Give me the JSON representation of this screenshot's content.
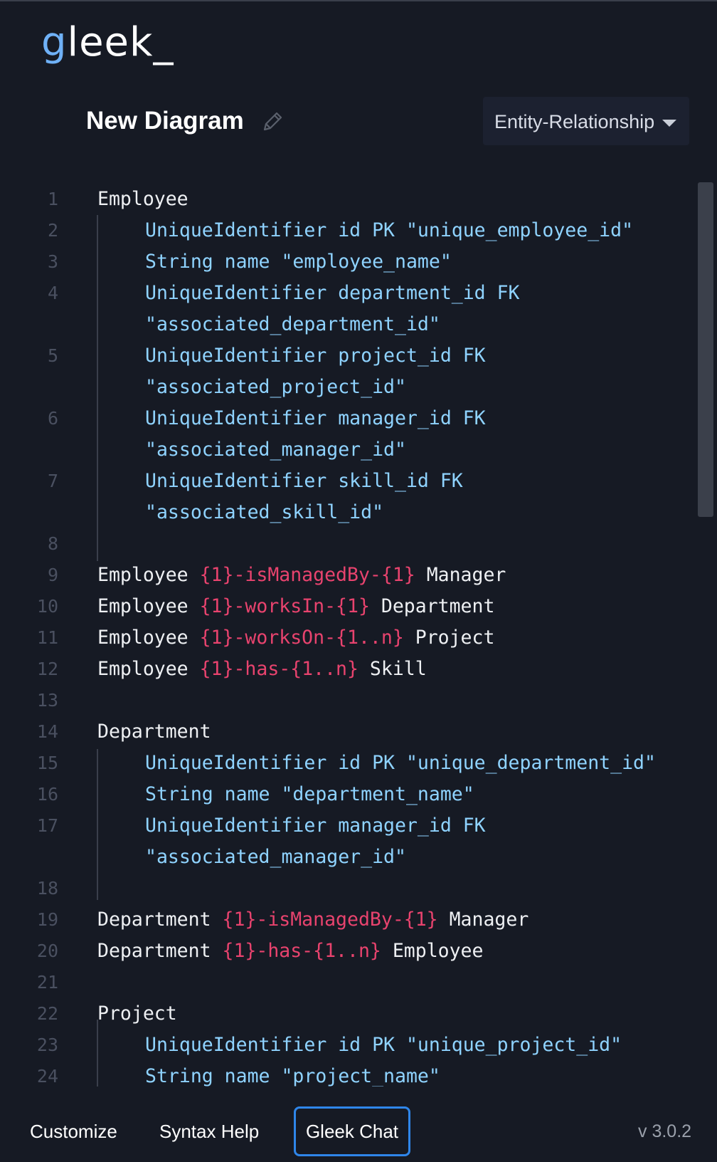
{
  "app": {
    "logo_prefix": "g",
    "logo_rest": "leek_",
    "diagram_title": "New Diagram",
    "diagram_type": "Entity-Relationship"
  },
  "editor": {
    "lines": [
      {
        "n": "1",
        "text": "Employee"
      },
      {
        "n": "2",
        "text": "UniqueIdentifier id PK \"unique_employee_id\""
      },
      {
        "n": "3",
        "text": "String name \"employee_name\""
      },
      {
        "n": "4",
        "text": "UniqueIdentifier department_id FK"
      },
      {
        "n": "",
        "text": "\"associated_department_id\""
      },
      {
        "n": "5",
        "text": "UniqueIdentifier project_id FK"
      },
      {
        "n": "",
        "text": "\"associated_project_id\""
      },
      {
        "n": "6",
        "text": "UniqueIdentifier manager_id FK"
      },
      {
        "n": "",
        "text": "\"associated_manager_id\""
      },
      {
        "n": "7",
        "text": "UniqueIdentifier skill_id FK"
      },
      {
        "n": "",
        "text": "\"associated_skill_id\""
      },
      {
        "n": "8",
        "text": ""
      },
      {
        "n": "9",
        "a": "Employee ",
        "rel": "{1}-isManagedBy-{1}",
        "b": " Manager"
      },
      {
        "n": "10",
        "a": "Employee ",
        "rel": "{1}-worksIn-{1}",
        "b": " Department"
      },
      {
        "n": "11",
        "a": "Employee ",
        "rel": "{1}-worksOn-{1..n}",
        "b": " Project"
      },
      {
        "n": "12",
        "a": "Employee ",
        "rel": "{1}-has-{1..n}",
        "b": " Skill"
      },
      {
        "n": "13",
        "text": ""
      },
      {
        "n": "14",
        "text": "Department"
      },
      {
        "n": "15",
        "text": "UniqueIdentifier id PK \"unique_department_id\""
      },
      {
        "n": "16",
        "text": "String name \"department_name\""
      },
      {
        "n": "17",
        "text": "UniqueIdentifier manager_id FK"
      },
      {
        "n": "",
        "text": "\"associated_manager_id\""
      },
      {
        "n": "18",
        "text": ""
      },
      {
        "n": "19",
        "a": "Department ",
        "rel": "{1}-isManagedBy-{1}",
        "b": " Manager"
      },
      {
        "n": "20",
        "a": "Department ",
        "rel": "{1}-has-{1..n}",
        "b": " Employee"
      },
      {
        "n": "21",
        "text": ""
      },
      {
        "n": "22",
        "text": "Project"
      },
      {
        "n": "23",
        "text": "UniqueIdentifier id PK \"unique_project_id\""
      },
      {
        "n": "24",
        "text": "String name \"project_name\""
      }
    ]
  },
  "footer": {
    "customize": "Customize",
    "syntax_help": "Syntax Help",
    "gleek_chat": "Gleek Chat",
    "version": "v 3.0.2"
  },
  "colors": {
    "background": "#161a24",
    "keyword": "#8fd3ff",
    "relation": "#e8436e",
    "accent": "#2f86ea"
  }
}
